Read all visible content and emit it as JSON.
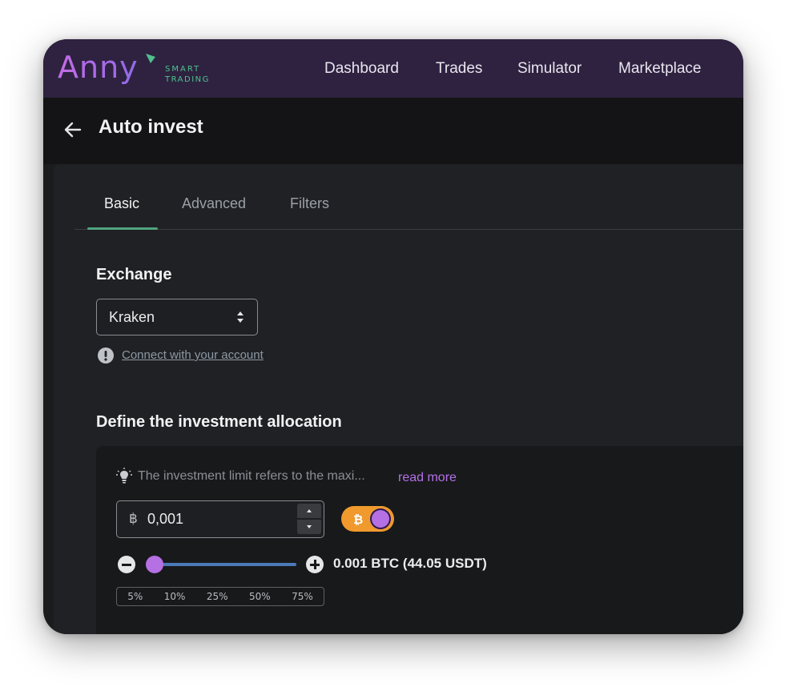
{
  "app": {
    "logo_text": "Anny",
    "logo_tagline_1": "SMART",
    "logo_tagline_2": "TRADING"
  },
  "nav": {
    "items": [
      "Dashboard",
      "Trades",
      "Simulator",
      "Marketplace"
    ]
  },
  "page": {
    "title": "Auto invest"
  },
  "tabs": [
    {
      "label": "Basic",
      "active": true
    },
    {
      "label": "Advanced",
      "active": false
    },
    {
      "label": "Filters",
      "active": false
    }
  ],
  "exchange": {
    "section_title": "Exchange",
    "selected": "Kraken",
    "connect_link": "Connect with your account"
  },
  "allocation": {
    "section_title": "Define the investment allocation",
    "hint": "The investment limit refers to the maxi...",
    "read_more": "read more",
    "currency_symbol": "฿",
    "amount": "0,001",
    "summary": "0.001 BTC (44.05 USDT)",
    "slider_level": 0,
    "percent_options": [
      "5%",
      "10%",
      "25%",
      "50%",
      "75%"
    ],
    "btc_toggle_on": true
  },
  "colors": {
    "topbar": "#2e2240",
    "accent_purple": "#b570e3",
    "tab_underline": "#4fa37f",
    "toggle_orange": "#f09a2e",
    "slider_blue": "#4c79b8"
  },
  "icons": {
    "back": "arrow-left-icon",
    "info": "exclamation-circle-icon",
    "hint": "lightbulb-icon",
    "toggle": "bitcoin-icon"
  }
}
